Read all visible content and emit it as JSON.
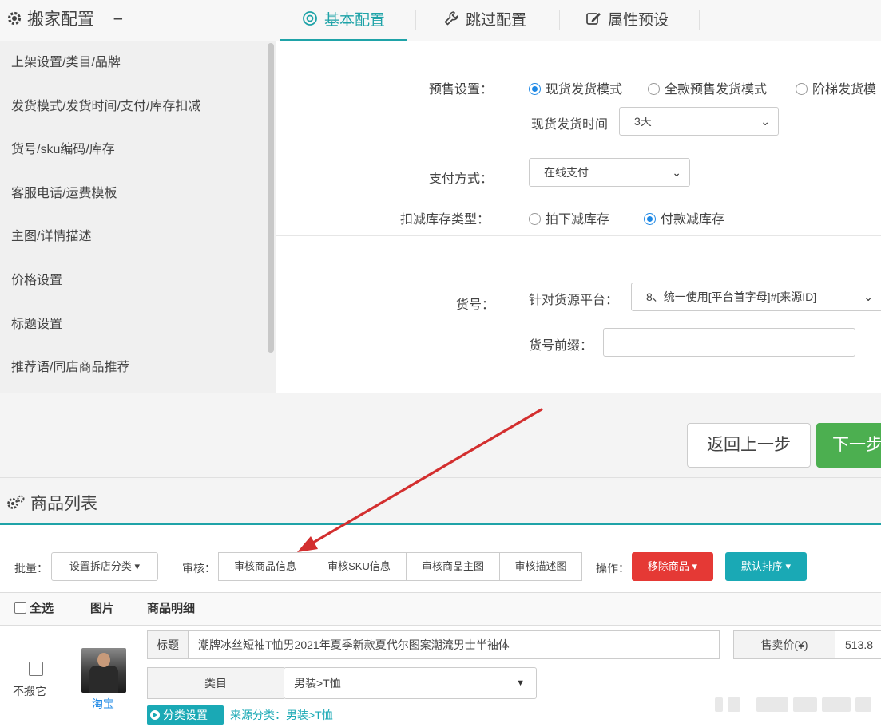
{
  "header": {
    "title": "搬家配置",
    "collapse": "–",
    "tabs": [
      {
        "label": "基本配置",
        "active": true
      },
      {
        "label": "跳过配置",
        "active": false
      },
      {
        "label": "属性预设",
        "active": false
      }
    ]
  },
  "sidebar": {
    "items": [
      {
        "label": "上架设置/类目/品牌"
      },
      {
        "label": "发货模式/发货时间/支付/库存扣减"
      },
      {
        "label": "货号/sku编码/库存"
      },
      {
        "label": "客服电话/运费模板"
      },
      {
        "label": "主图/详情描述"
      },
      {
        "label": "价格设置"
      },
      {
        "label": "标题设置"
      },
      {
        "label": "推荐语/同店商品推荐"
      }
    ]
  },
  "config": {
    "presale_label": "预售设置：",
    "presale_options": [
      "现货发货模式",
      "全款预售发货模式",
      "阶梯发货模"
    ],
    "presale_selected": "现货发货模式",
    "ship_time_label": "现货发货时间",
    "ship_time_value": "3天",
    "payment_label": "支付方式：",
    "payment_value": "在线支付",
    "stock_label": "扣减库存类型：",
    "stock_options": [
      "拍下减库存",
      "付款减库存"
    ],
    "stock_selected": "付款减库存",
    "sku_label": "货号：",
    "platform_label": "针对货源平台：",
    "platform_value": "8、统一使用[平台首字母]#[来源ID]",
    "prefix_label": "货号前缀：",
    "prefix_value": ""
  },
  "nav_buttons": {
    "back": "返回上一步",
    "next": "下一步"
  },
  "product_list": {
    "title": "商品列表",
    "batch_label": "批量：",
    "batch_button": "设置拆店分类",
    "review_label": "审核：",
    "review_buttons": [
      "审核商品信息",
      "审核SKU信息",
      "审核商品主图",
      "审核描述图"
    ],
    "operate_label": "操作：",
    "remove_button": "移除商品",
    "sort_button": "默认排序",
    "columns": {
      "select_all": "全选",
      "image": "图片",
      "detail": "商品明细"
    },
    "row": {
      "skip_label": "不搬它",
      "source": "淘宝",
      "title_label": "标题",
      "title_value": "潮牌冰丝短袖T恤男2021年夏季新款夏代尔图案潮流男士半袖体",
      "category_label": "类目",
      "category_value": "男装>T恤",
      "price_label": "售卖价(¥)",
      "price_value": "513.8",
      "tag_label": "分类设置",
      "source_category": "来源分类：男装>T恤"
    }
  },
  "colors": {
    "accent": "#1fa3a8",
    "green": "#4caf50",
    "red": "#e53935",
    "arrow": "#d32f2f"
  }
}
